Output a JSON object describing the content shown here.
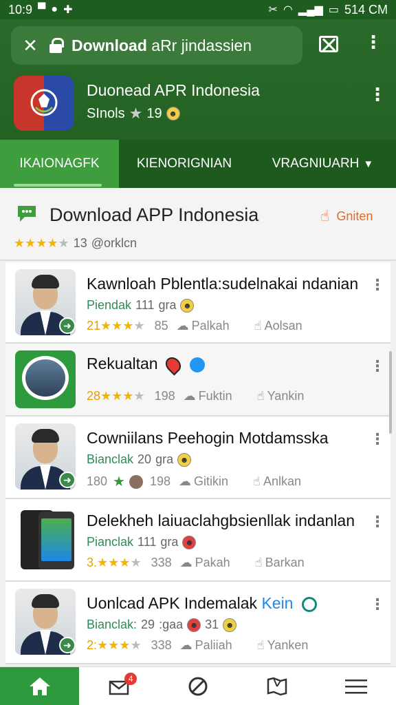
{
  "status_bar": {
    "time": "10:9",
    "right_text": "514 CM"
  },
  "browser": {
    "close_icon": "close-icon",
    "url_bold": "Download",
    "url_rest": " aRr jindassien"
  },
  "app_header": {
    "title": "Duonead APR Indonesia",
    "subtitle": "SInols",
    "rating": "19"
  },
  "tabs": [
    {
      "label": "IKAIONAGFK",
      "active": true
    },
    {
      "label": "KIENORIGNIAN",
      "active": false
    },
    {
      "label": "VRAGNIUARH",
      "active": false
    }
  ],
  "section": {
    "title": "Download APP Indonesia",
    "action_label": "Gniten",
    "rating_count": "13",
    "rating_user": "@orklcn",
    "stars": 4
  },
  "items": [
    {
      "title": "Kawnloah Pblentla:sudelnakai ndanian",
      "meta_label": "Piendak",
      "meta_value": "111",
      "meta_sub": "gra",
      "stat_count": "21",
      "stat_num": "85",
      "share_label": "Palkah",
      "like_label": "Aolsan"
    },
    {
      "title": "Rekualtan",
      "stat_count": "28",
      "stat_num": "198",
      "share_label": "Fuktin",
      "like_label": "Yankin"
    },
    {
      "title": "Cowniilans Peehogin Motdamsska",
      "meta_label": "Bianclak",
      "meta_value": "20",
      "meta_sub": "gra",
      "stat_count": "180",
      "stat_num": "198",
      "share_label": "Gitikin",
      "like_label": "Anlkan"
    },
    {
      "title": "Delekheh laiuaclahgbsienllak indanlan",
      "meta_label": "Pianclak",
      "meta_value": "111",
      "meta_sub": "gra",
      "stat_count": "3.",
      "stat_num": "338",
      "share_label": "Pakah",
      "like_label": "Barkan"
    },
    {
      "title": "Uonlcad APK Indemalak",
      "title_accent": "Kein",
      "meta_label": "Bianclak:",
      "meta_value": "29",
      "meta_sub": ":gaa",
      "meta_extra": "31",
      "stat_count": "2:",
      "stat_num": "338",
      "share_label": "Paliiah",
      "like_label": "Yanken"
    }
  ],
  "bottom_nav": {
    "mail_badge": "4"
  },
  "colors": {
    "header_green": "#2a6a2a",
    "tab_active": "#3e9e3e",
    "accent_orange": "#e06a2a",
    "star_gold": "#f4b400"
  }
}
